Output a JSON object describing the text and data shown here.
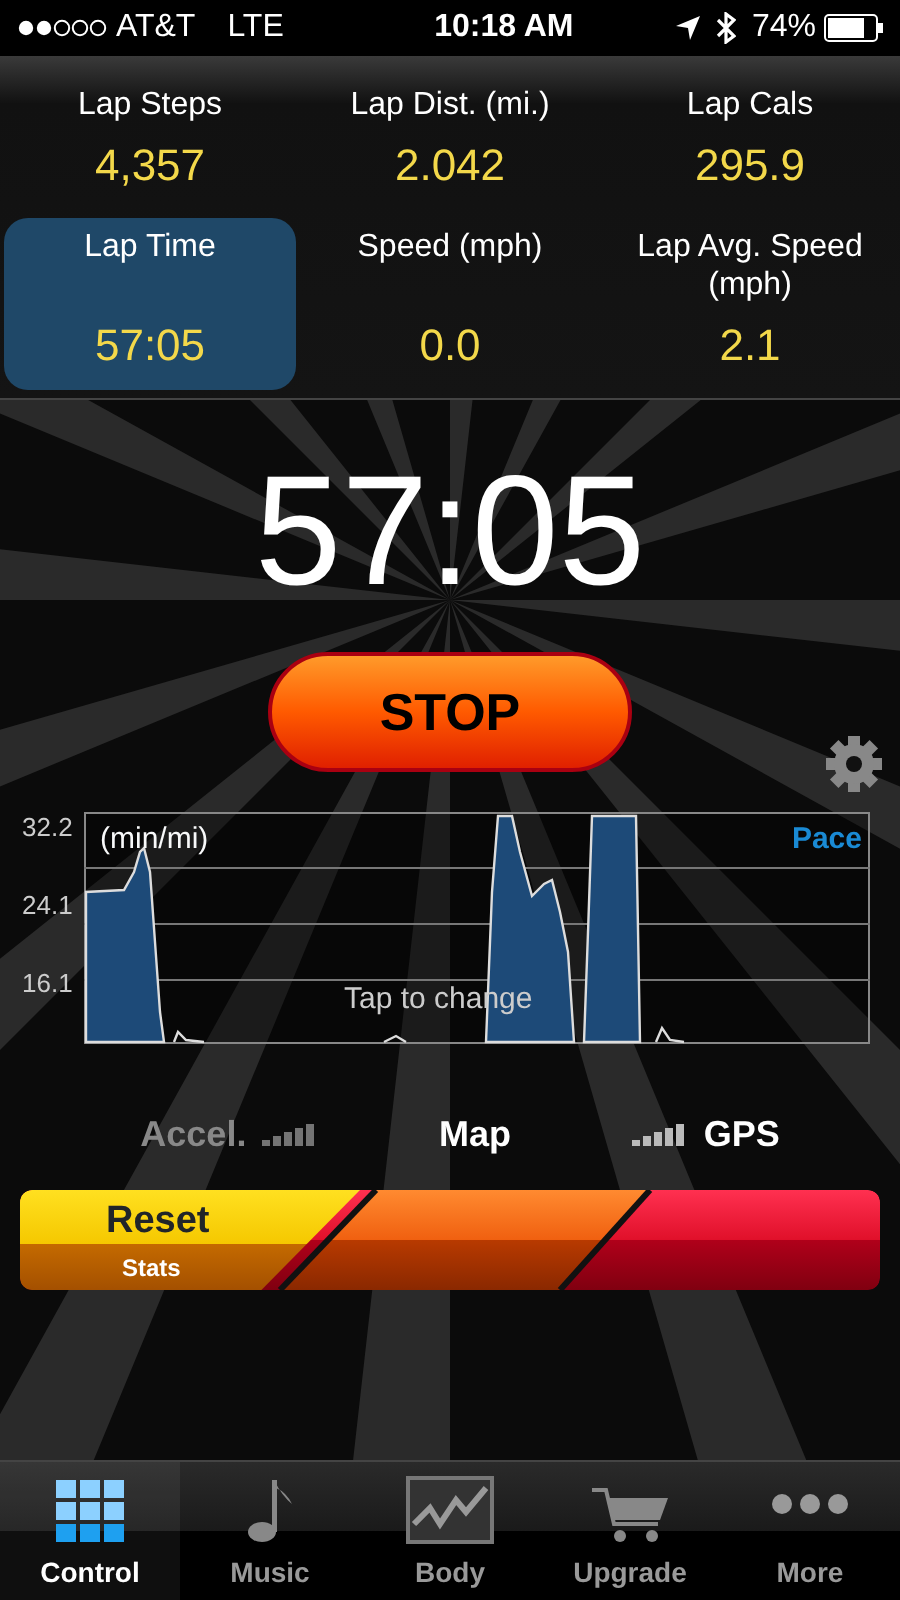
{
  "status_bar": {
    "carrier": "AT&T",
    "network": "LTE",
    "time": "10:18 AM",
    "battery": "74%"
  },
  "stats": [
    {
      "label": "Lap Steps",
      "value": "4,357",
      "selected": false
    },
    {
      "label": "Lap Dist. (mi.)",
      "value": "2.042",
      "selected": false
    },
    {
      "label": "Lap Cals",
      "value": "295.9",
      "selected": false
    },
    {
      "label": "Lap Time",
      "value": "57:05",
      "selected": true
    },
    {
      "label": "Speed (mph)",
      "value": "0.0",
      "selected": false
    },
    {
      "label": "Lap Avg. Speed (mph)",
      "value": "2.1",
      "selected": false
    }
  ],
  "timer": "57:05",
  "stop_button": "STOP",
  "chart": {
    "y_ticks": [
      "32.2",
      "24.1",
      "16.1"
    ],
    "unit": "(min/mi)",
    "metric": "Pace",
    "hint": "Tap to change"
  },
  "sources": [
    {
      "label": "Accel.",
      "kind": "bars-after",
      "active": false
    },
    {
      "label": "Map",
      "kind": "plain",
      "active": true
    },
    {
      "label": "GPS",
      "kind": "bars-before",
      "active": true
    }
  ],
  "reset_slider": {
    "title": "Reset",
    "subtitle": "Stats"
  },
  "tabs": [
    {
      "label": "Control",
      "kind": "grid",
      "selected": true
    },
    {
      "label": "Music",
      "kind": "note",
      "selected": false
    },
    {
      "label": "Body",
      "kind": "graph",
      "selected": false
    },
    {
      "label": "Upgrade",
      "kind": "cart",
      "selected": false
    },
    {
      "label": "More",
      "kind": "dots",
      "selected": false
    }
  ]
}
